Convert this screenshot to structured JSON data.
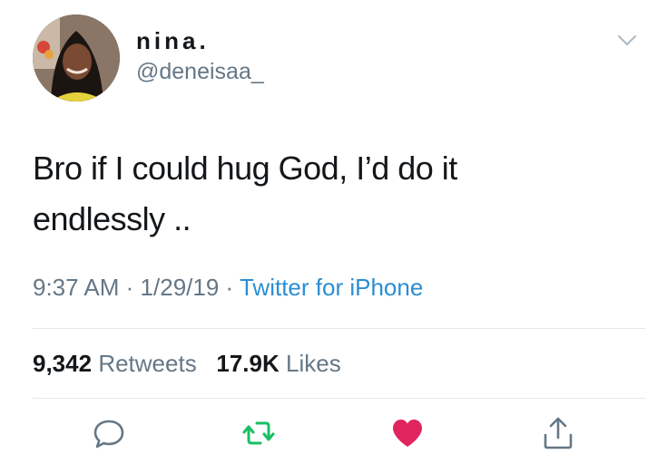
{
  "user": {
    "display_name": "nina.",
    "handle": "@deneisaa_"
  },
  "tweet": {
    "text_line1": "Bro if I could hug God, I’d do it",
    "text_line2": "endlessly ..",
    "time": "9:37 AM",
    "date": "1/29/19",
    "separator": "·",
    "source": "Twitter for iPhone"
  },
  "stats": {
    "retweets_count": "9,342",
    "retweets_label": "Retweets",
    "likes_count": "17.9K",
    "likes_label": "Likes"
  },
  "actions": {
    "reply_icon": "reply-icon",
    "retweet_icon": "retweet-icon",
    "like_icon": "heart-icon",
    "share_icon": "share-icon"
  },
  "colors": {
    "link": "#2b8ed3",
    "retweet": "#17bf63",
    "like": "#e0245e",
    "secondary_text": "#657786"
  }
}
